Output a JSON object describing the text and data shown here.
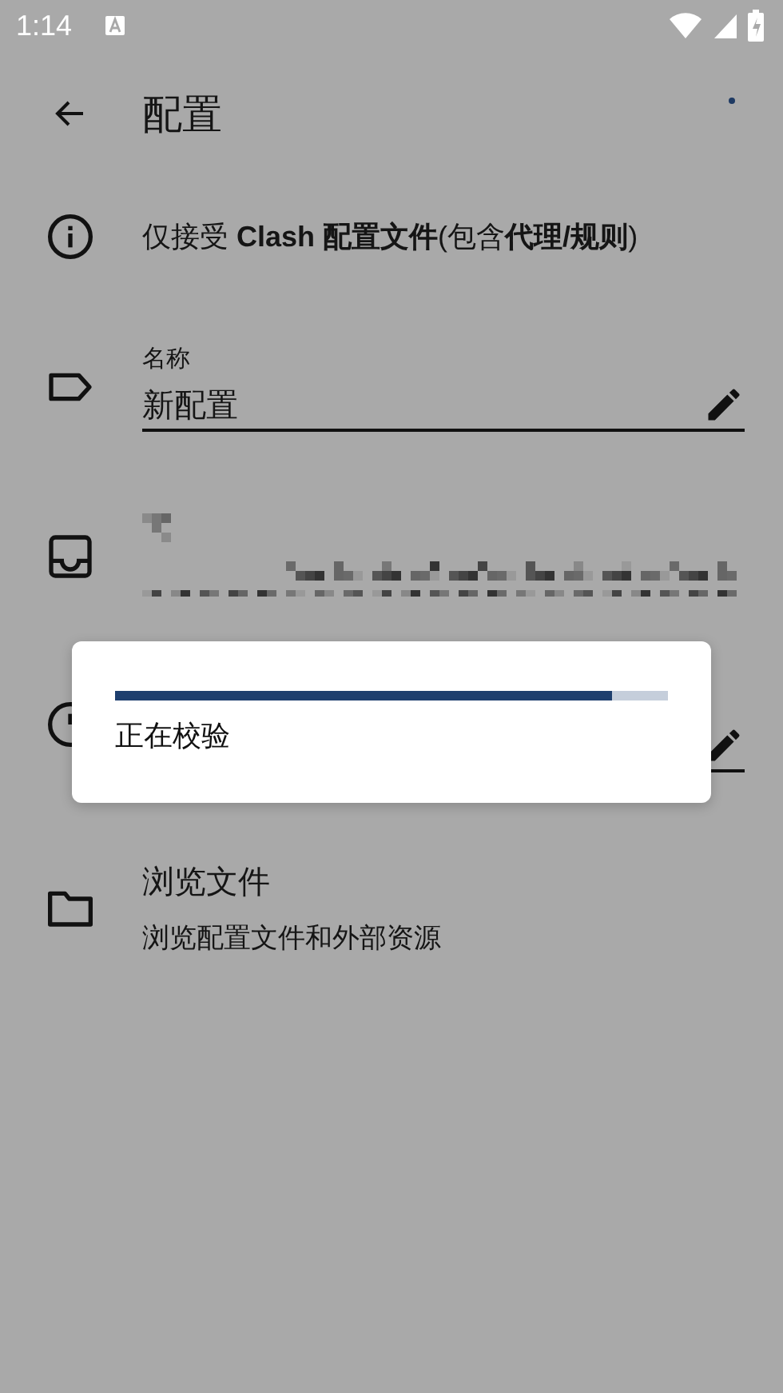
{
  "status_bar": {
    "time": "1:14"
  },
  "app_bar": {
    "title": "配置"
  },
  "notice": "仅接受 **Clash 配置文件**(包含**代理/规则**)",
  "fields": [
    {
      "kind": "name",
      "label": "名称",
      "value": "新配置"
    },
    {
      "kind": "url"
    },
    {
      "kind": "interval"
    }
  ],
  "browse": {
    "title": "浏览文件",
    "subtitle": "浏览配置文件和外部资源"
  },
  "dialog": {
    "message": "正在校验",
    "progress": {
      "level": 0.9
    }
  }
}
